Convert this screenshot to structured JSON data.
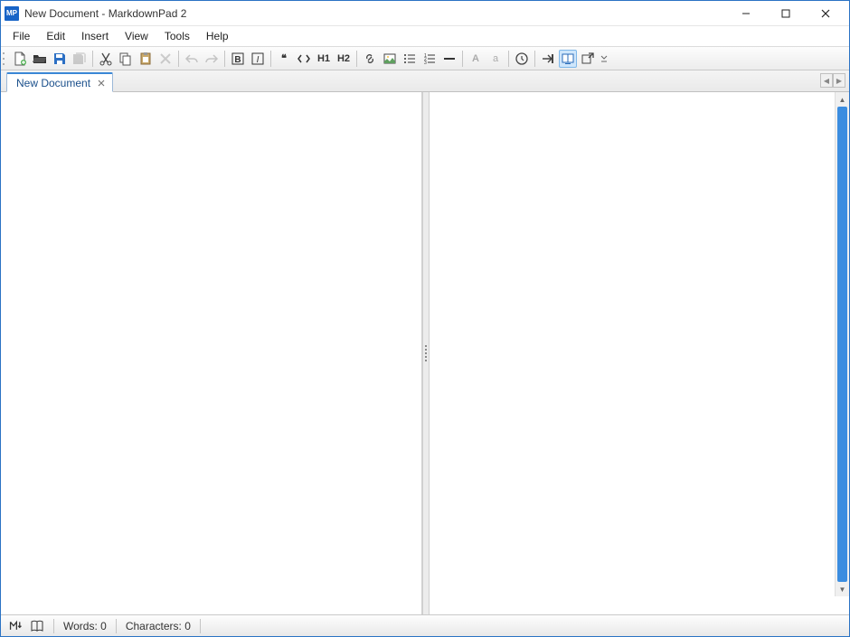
{
  "title": "New Document - MarkdownPad 2",
  "app_icon_text": "MP",
  "menubar": {
    "items": [
      "File",
      "Edit",
      "Insert",
      "View",
      "Tools",
      "Help"
    ]
  },
  "tabs": {
    "items": [
      {
        "label": "New Document"
      }
    ]
  },
  "statusbar": {
    "words_label": "Words:",
    "words_value": "0",
    "chars_label": "Characters:",
    "chars_value": "0"
  },
  "toolbar": {
    "h1": "H1",
    "h2": "H2",
    "uppercase_a": "A",
    "lowercase_a": "a",
    "quote_mark": "❝"
  }
}
